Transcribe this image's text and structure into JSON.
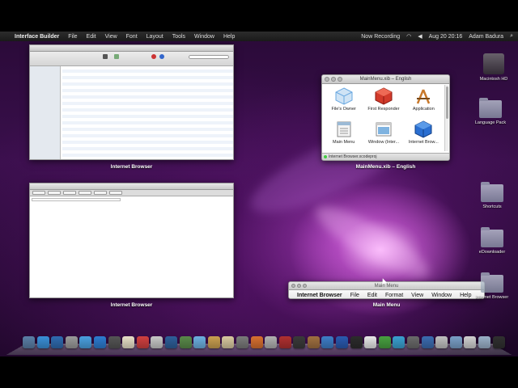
{
  "menubar": {
    "apple_glyph": "",
    "app_name": "Interface Builder",
    "items": [
      "File",
      "Edit",
      "View",
      "Font",
      "Layout",
      "Tools",
      "Window",
      "Help"
    ],
    "status_recording": "Now Recording",
    "clock": "Aug 20  20:16",
    "user": "Adam Badura"
  },
  "windows": [
    {
      "caption": "Internet Browser"
    },
    {
      "caption": "Internet Browser"
    }
  ],
  "xib_window": {
    "title": "MainMenu.xib – English",
    "caption": "MainMenu.xib – English",
    "objects": [
      {
        "label": "File's Owner",
        "icon": "cube-outline-icon",
        "color": "#6aa8e0"
      },
      {
        "label": "First Responder",
        "icon": "cube-red-icon",
        "color": "#d23b2b"
      },
      {
        "label": "Application",
        "icon": "app-store-icon",
        "color": "#c8782a"
      },
      {
        "label": "Main Menu",
        "icon": "menu-icon",
        "color": "#9bbad6"
      },
      {
        "label": "Window (Inter...",
        "icon": "window-icon",
        "color": "#7fb3e0"
      },
      {
        "label": "Internet Brow...",
        "icon": "cube-blue-icon",
        "color": "#2a6fd1"
      }
    ],
    "status": "Internet Browser.xcodeproj"
  },
  "main_menu_window": {
    "title": "Main Menu",
    "caption": "Main Menu",
    "items": [
      "Internet Browser",
      "File",
      "Edit",
      "Format",
      "View",
      "Window",
      "Help"
    ]
  },
  "desktop_icons": [
    {
      "label": "Macintosh HD",
      "icon": "hard-drive-icon"
    },
    {
      "label": "Language Pack",
      "icon": "folder-icon"
    },
    {
      "label": "Shortcuts",
      "icon": "folder-icon"
    },
    {
      "label": "eDownloader",
      "icon": "folder-icon"
    },
    {
      "label": "Internet Browser",
      "icon": "folder-icon"
    }
  ],
  "dock_colors": [
    "#5b7fa6",
    "#3a8fd8",
    "#2f6bb0",
    "#9a9a9a",
    "#4aa0e0",
    "#2d7cd0",
    "#555",
    "#e8e0c8",
    "#d04040",
    "#c8c8c8",
    "#2e5f9a",
    "#5a8a4a",
    "#6cb0e0",
    "#caa050",
    "#d9c9a0",
    "#7a7a7a",
    "#d87030",
    "#b0b0b0",
    "#b03030",
    "#3a3a3a",
    "#a07040",
    "#3e7ec8",
    "#2a5ab0",
    "#2c2c2c",
    "#e8e8e8",
    "#48a040",
    "#3aa0d0",
    "#6a6a6a",
    "#3c6cb0",
    "#c0c0c0",
    "#7aa0c8",
    "#d0d0d0",
    "#9ab0c8",
    "#303030"
  ]
}
